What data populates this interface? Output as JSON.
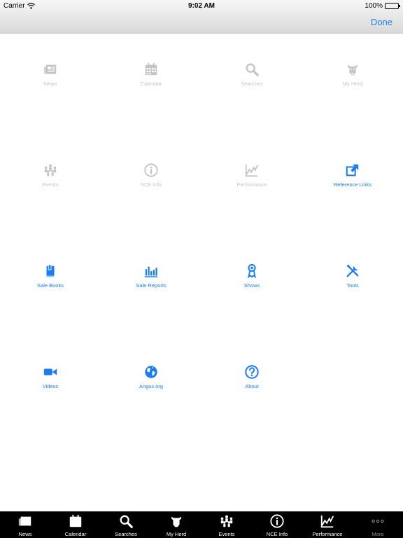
{
  "status_bar": {
    "carrier": "Carrier",
    "time": "9:02 AM",
    "battery": "100%"
  },
  "nav": {
    "done_label": "Done"
  },
  "colors": {
    "accent": "#1a7df0",
    "disabled": "#c4c4c4",
    "tabbar_bg": "#000000"
  },
  "grid_items": [
    {
      "label": "News",
      "icon": "newspaper-icon",
      "enabled": false
    },
    {
      "label": "Calendar",
      "icon": "calendar-icon",
      "enabled": false
    },
    {
      "label": "Searches",
      "icon": "search-icon",
      "enabled": false
    },
    {
      "label": "My Herd",
      "icon": "cow-head-icon",
      "enabled": false
    },
    {
      "label": "Events",
      "icon": "people-group-icon",
      "enabled": false
    },
    {
      "label": "NCE Info",
      "icon": "info-icon",
      "enabled": false
    },
    {
      "label": "Performance",
      "icon": "chart-line-icon",
      "enabled": false
    },
    {
      "label": "Reference Links",
      "icon": "external-link-icon",
      "enabled": true
    },
    {
      "label": "Sale Books",
      "icon": "book-icon",
      "enabled": true
    },
    {
      "label": "Sale Reports",
      "icon": "bar-chart-icon",
      "enabled": true
    },
    {
      "label": "Shows",
      "icon": "ribbon-icon",
      "enabled": true
    },
    {
      "label": "Tools",
      "icon": "tools-icon",
      "enabled": true
    },
    {
      "label": "Videos",
      "icon": "video-camera-icon",
      "enabled": true
    },
    {
      "label": "Angus.org",
      "icon": "globe-icon",
      "enabled": true
    },
    {
      "label": "About",
      "icon": "question-icon",
      "enabled": true
    }
  ],
  "tabs": [
    {
      "label": "News",
      "icon": "newspaper-icon"
    },
    {
      "label": "Calendar",
      "icon": "calendar-icon"
    },
    {
      "label": "Searches",
      "icon": "search-icon"
    },
    {
      "label": "My Herd",
      "icon": "cow-head-icon"
    },
    {
      "label": "Events",
      "icon": "people-group-icon"
    },
    {
      "label": "NCE Info",
      "icon": "info-icon"
    },
    {
      "label": "Performance",
      "icon": "chart-line-icon"
    },
    {
      "label": "More",
      "icon": "more-dots-icon"
    }
  ]
}
